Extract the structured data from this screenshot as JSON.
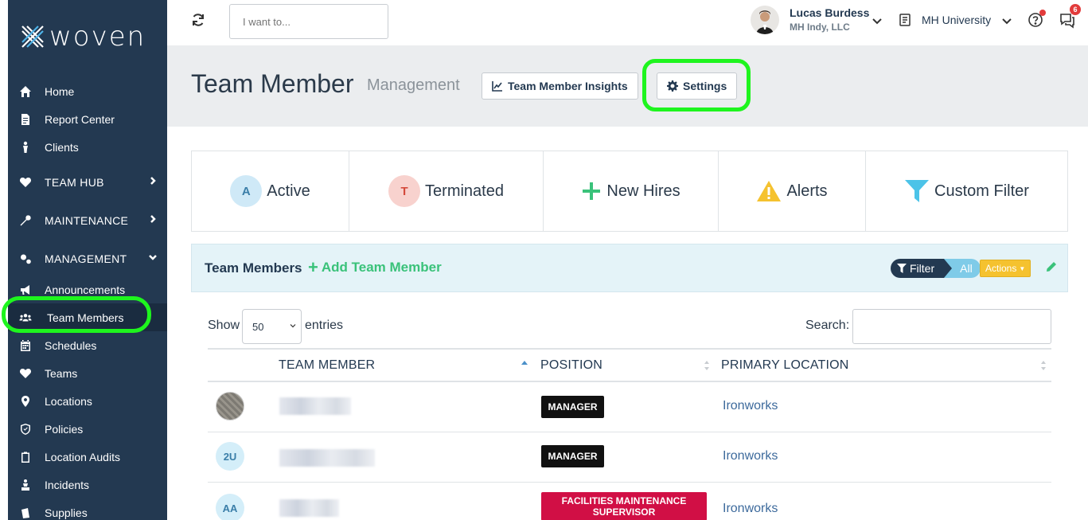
{
  "app": {
    "brand": "woven"
  },
  "sidebar": {
    "items": [
      {
        "label": "Home",
        "icon": "home-icon"
      },
      {
        "label": "Report Center",
        "icon": "report-icon"
      },
      {
        "label": "Clients",
        "icon": "person-icon"
      },
      {
        "label": "TEAM HUB",
        "icon": "heart-icon"
      },
      {
        "label": "MAINTENANCE",
        "icon": "wrench-icon"
      },
      {
        "label": "MANAGEMENT",
        "icon": "gears-icon"
      },
      {
        "label": "Announcements",
        "icon": "megaphone-icon"
      },
      {
        "label": "Team Members",
        "icon": "users-icon"
      },
      {
        "label": "Schedules",
        "icon": "calendar-icon"
      },
      {
        "label": "Teams",
        "icon": "heart-icon"
      },
      {
        "label": "Locations",
        "icon": "map-pin-icon"
      },
      {
        "label": "Policies",
        "icon": "shield-icon"
      },
      {
        "label": "Location Audits",
        "icon": "clipboard-icon"
      },
      {
        "label": "Incidents",
        "icon": "incident-icon"
      },
      {
        "label": "Supplies",
        "icon": "supplies-icon"
      }
    ]
  },
  "topbar": {
    "search_placeholder": "I want to...",
    "user_name": "Lucas Burdess",
    "user_org": "MH Indy, LLC",
    "university": "MH University",
    "chat_badge": "6"
  },
  "header": {
    "title": "Team Member",
    "subtitle": "Management",
    "insights_label": "Team Member Insights",
    "settings_label": "Settings"
  },
  "filters": {
    "active": {
      "initial": "A",
      "label": "Active"
    },
    "terminated": {
      "initial": "T",
      "label": "Terminated"
    },
    "new_hires": {
      "label": "New Hires"
    },
    "alerts": {
      "label": "Alerts"
    },
    "custom": {
      "label": "Custom Filter"
    }
  },
  "panel": {
    "title": "Team Members",
    "add_label": "Add Team Member",
    "filter_label": "Filter",
    "filter_value": "All",
    "actions_label": "Actions"
  },
  "table": {
    "show_label": "Show",
    "show_value": "50",
    "entries_label": "entries",
    "search_label": "Search:",
    "columns": [
      "TEAM MEMBER",
      "POSITION",
      "PRIMARY LOCATION"
    ],
    "rows": [
      {
        "initials": "",
        "position": "MANAGER",
        "location": "Ironworks",
        "position_color": "#111111"
      },
      {
        "initials": "2U",
        "position": "MANAGER",
        "location": "Ironworks",
        "position_color": "#111111"
      },
      {
        "initials": "AA",
        "position": "FACILITIES MAINTENANCE SUPERVISOR",
        "location": "Ironworks",
        "position_color": "#d10f45"
      }
    ]
  },
  "colors": {
    "sidebar": "#233951",
    "accent_green": "#3ac27a",
    "highlight": "#1ef51e"
  }
}
